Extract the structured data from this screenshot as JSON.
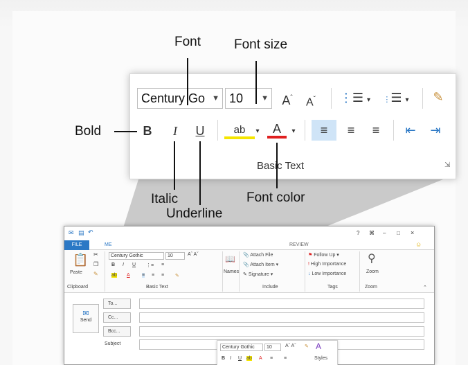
{
  "annotations": {
    "font": "Font",
    "font_size": "Font size",
    "bold": "Bold",
    "italic": "Italic",
    "underline": "Underline",
    "font_color": "Font color"
  },
  "zoom_ribbon": {
    "font_value": "Century Go",
    "font_size_value": "10",
    "bold_label": "B",
    "italic_label": "I",
    "underline_label": "U",
    "font_color_glyph": "A",
    "grow_font_glyph": "A",
    "shrink_font_glyph": "A",
    "group_label": "Basic Text"
  },
  "mini_window": {
    "file_tab": "FILE",
    "message_tab": "ME",
    "review_tab": "REVIEW",
    "title_controls": [
      "?",
      "⌘",
      "–",
      "□",
      "×"
    ],
    "paste_label": "Paste",
    "clipboard_label": "Clipboard",
    "font_value": "Century Gothic",
    "font_size_value": "10",
    "basic_text_label": "Basic Text",
    "names_label": "Names",
    "attach_file": "Attach File",
    "attach_item": "Attach Item",
    "signature": "Signature",
    "include_label": "Include",
    "follow_up": "Follow Up",
    "high_importance": "High Importance",
    "low_importance": "Low Importance",
    "tags_label": "Tags",
    "zoom_label": "Zoom",
    "zoom_group_label": "Zoom",
    "send_label": "Send",
    "to_label": "To...",
    "cc_label": "Cc...",
    "bcc_label": "Bcc...",
    "subject_label": "Subject",
    "mini_toolbar_font": "Century Gothic",
    "mini_toolbar_size": "10",
    "mini_toolbar_styles": "Styles"
  },
  "colors": {
    "accent_blue": "#2b78c5",
    "font_color_red": "#e02020",
    "highlight_yellow": "#f5e500",
    "selected_align_bg": "#cfe4f7"
  },
  "icons": [
    "grow-font-icon",
    "shrink-font-icon",
    "bullets-icon",
    "numbering-icon",
    "clear-formatting-icon",
    "highlight-icon",
    "font-color-icon",
    "align-left-icon",
    "align-center-icon",
    "align-right-icon",
    "decrease-indent-icon",
    "increase-indent-icon",
    "dialog-launcher-icon",
    "zoom-icon",
    "send-icon"
  ]
}
